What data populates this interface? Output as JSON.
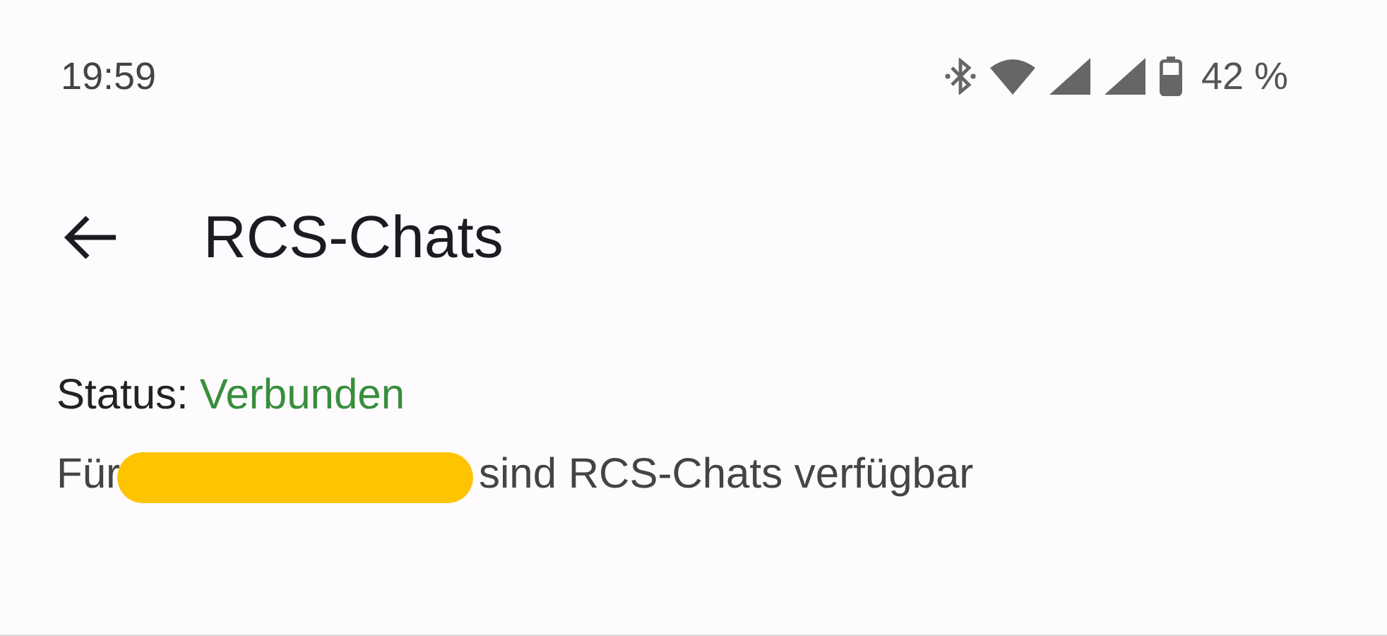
{
  "status_bar": {
    "time": "19:59",
    "battery": "42 %"
  },
  "app_bar": {
    "title": "RCS-Chats"
  },
  "status": {
    "label": "Status:",
    "value": "Verbunden",
    "connected": true
  },
  "availability": {
    "before": "Für",
    "after": "sind RCS-Chats verfügbar",
    "redacted": true
  }
}
